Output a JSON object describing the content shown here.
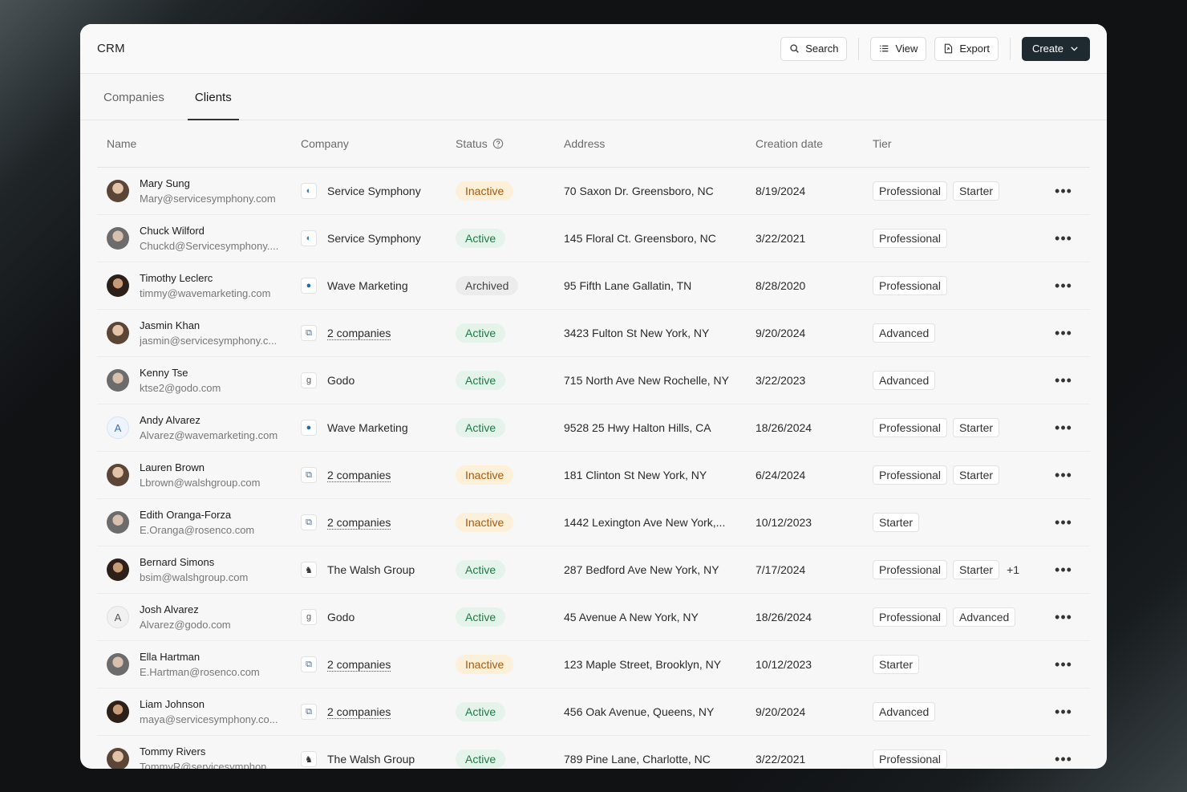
{
  "app": {
    "title": "CRM"
  },
  "toolbar": {
    "search_label": "Search",
    "view_label": "View",
    "export_label": "Export",
    "create_label": "Create"
  },
  "tabs": [
    {
      "label": "Companies",
      "active": false
    },
    {
      "label": "Clients",
      "active": true
    }
  ],
  "table": {
    "headers": {
      "name": "Name",
      "company": "Company",
      "status": "Status",
      "address": "Address",
      "date": "Creation date",
      "tier": "Tier"
    },
    "rows": [
      {
        "name": "Mary Sung",
        "email": "Mary@servicesymphony.com",
        "avatar": "photo",
        "avatar_letter": "",
        "company": "Service Symphony",
        "company_icon": "service-symphony-icon",
        "company_multi": false,
        "status": "Inactive",
        "address": "70 Saxon Dr. Greensboro, NC",
        "date": "8/19/2024",
        "tiers": [
          "Professional",
          "Starter"
        ],
        "tier_more": ""
      },
      {
        "name": "Chuck Wilford",
        "email": "Chuckd@Servicesymphony....",
        "avatar": "photo",
        "avatar_letter": "",
        "company": "Service Symphony",
        "company_icon": "service-symphony-icon",
        "company_multi": false,
        "status": "Active",
        "address": "145 Floral Ct. Greensboro, NC",
        "date": "3/22/2021",
        "tiers": [
          "Professional"
        ],
        "tier_more": ""
      },
      {
        "name": "Timothy Leclerc",
        "email": "timmy@wavemarketing.com",
        "avatar": "photo",
        "avatar_letter": "",
        "company": "Wave Marketing",
        "company_icon": "wave-marketing-icon",
        "company_multi": false,
        "status": "Archived",
        "address": "95 Fifth Lane Gallatin, TN",
        "date": "8/28/2020",
        "tiers": [
          "Professional"
        ],
        "tier_more": ""
      },
      {
        "name": "Jasmin Khan",
        "email": "jasmin@servicesymphony.c...",
        "avatar": "photo",
        "avatar_letter": "",
        "company": "2 companies",
        "company_icon": "multiple-companies-icon",
        "company_multi": true,
        "status": "Active",
        "address": "3423 Fulton St New York, NY",
        "date": "9/20/2024",
        "tiers": [
          "Advanced"
        ],
        "tier_more": ""
      },
      {
        "name": "Kenny Tse",
        "email": "ktse2@godo.com",
        "avatar": "photo",
        "avatar_letter": "",
        "company": "Godo",
        "company_icon": "godo-icon",
        "company_multi": false,
        "status": "Active",
        "address": "715 North Ave New Rochelle, NY",
        "date": "3/22/2023",
        "tiers": [
          "Advanced"
        ],
        "tier_more": ""
      },
      {
        "name": "Andy Alvarez",
        "email": "Alvarez@wavemarketing.com",
        "avatar": "letter-blue",
        "avatar_letter": "A",
        "company": "Wave Marketing",
        "company_icon": "wave-marketing-icon",
        "company_multi": false,
        "status": "Active",
        "address": "9528 25 Hwy Halton Hills, CA",
        "date": "18/26/2024",
        "tiers": [
          "Professional",
          "Starter"
        ],
        "tier_more": ""
      },
      {
        "name": "Lauren Brown",
        "email": "Lbrown@walshgroup.com",
        "avatar": "photo",
        "avatar_letter": "",
        "company": "2 companies",
        "company_icon": "multiple-companies-icon",
        "company_multi": true,
        "status": "Inactive",
        "address": "181 Clinton St New York, NY",
        "date": "6/24/2024",
        "tiers": [
          "Professional",
          "Starter"
        ],
        "tier_more": ""
      },
      {
        "name": "Edith Oranga-Forza",
        "email": "E.Oranga@rosenco.com",
        "avatar": "photo",
        "avatar_letter": "",
        "company": "2 companies",
        "company_icon": "multiple-companies-icon",
        "company_multi": true,
        "status": "Inactive",
        "address": "1442 Lexington Ave New York,...",
        "date": "10/12/2023",
        "tiers": [
          "Starter"
        ],
        "tier_more": ""
      },
      {
        "name": "Bernard Simons",
        "email": "bsim@walshgroup.com",
        "avatar": "photo",
        "avatar_letter": "",
        "company": "The Walsh Group",
        "company_icon": "walsh-group-icon",
        "company_multi": false,
        "status": "Active",
        "address": "287 Bedford Ave New York, NY",
        "date": "7/17/2024",
        "tiers": [
          "Professional",
          "Starter"
        ],
        "tier_more": "+1"
      },
      {
        "name": "Josh Alvarez",
        "email": "Alvarez@godo.com",
        "avatar": "letter",
        "avatar_letter": "A",
        "company": "Godo",
        "company_icon": "godo-icon",
        "company_multi": false,
        "status": "Active",
        "address": "45 Avenue A New York, NY",
        "date": "18/26/2024",
        "tiers": [
          "Professional",
          "Advanced"
        ],
        "tier_more": ""
      },
      {
        "name": "Ella Hartman",
        "email": "E.Hartman@rosenco.com",
        "avatar": "photo",
        "avatar_letter": "",
        "company": "2 companies",
        "company_icon": "multiple-companies-icon",
        "company_multi": true,
        "status": "Inactive",
        "address": "123 Maple Street, Brooklyn, NY",
        "date": "10/12/2023",
        "tiers": [
          "Starter"
        ],
        "tier_more": ""
      },
      {
        "name": "Liam Johnson",
        "email": "maya@servicesymphony.co...",
        "avatar": "photo",
        "avatar_letter": "",
        "company": "2 companies",
        "company_icon": "multiple-companies-icon",
        "company_multi": true,
        "status": "Active",
        "address": "456 Oak Avenue, Queens, NY",
        "date": "9/20/2024",
        "tiers": [
          "Advanced"
        ],
        "tier_more": ""
      },
      {
        "name": "Tommy Rivers",
        "email": "TommyR@servicesymphon...",
        "avatar": "photo",
        "avatar_letter": "",
        "company": "The Walsh Group",
        "company_icon": "walsh-group-icon",
        "company_multi": false,
        "status": "Active",
        "address": "789 Pine Lane, Charlotte, NC",
        "date": "3/22/2021",
        "tiers": [
          "Professional"
        ],
        "tier_more": ""
      }
    ]
  },
  "colors": {
    "active_bg": "#e4f4ea",
    "active_text": "#1d7a45",
    "inactive_bg": "#fdf0d8",
    "inactive_text": "#a85a0c",
    "archived_bg": "#ececec",
    "archived_text": "#444444",
    "primary_button": "#1f2a30"
  }
}
